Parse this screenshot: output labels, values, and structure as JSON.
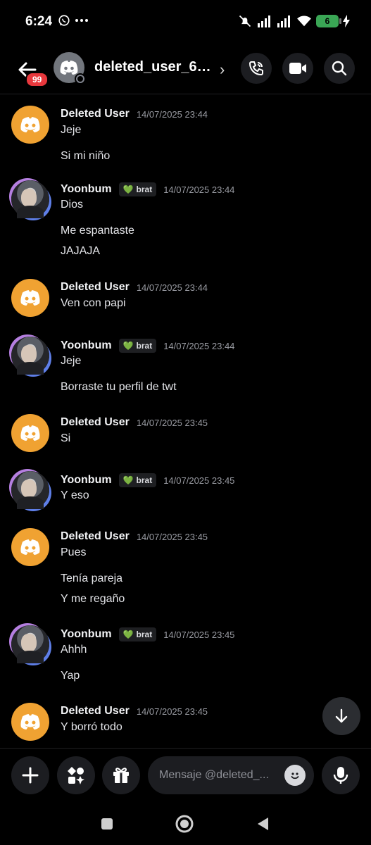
{
  "status_bar": {
    "time": "6:24",
    "battery": "6"
  },
  "header": {
    "title": "deleted_user_69...",
    "unread_badge": "99"
  },
  "messages": [
    {
      "author": "Deleted User",
      "avatar": "discord-logo",
      "timestamp": "14/07/2025 23:44",
      "lines": [
        "Jeje",
        "Si mi niño"
      ]
    },
    {
      "author": "Yoonbum",
      "avatar": "photo",
      "tag": "brat",
      "timestamp": "14/07/2025 23:44",
      "lines": [
        "Dios",
        "Me espantaste",
        "JAJAJA"
      ]
    },
    {
      "author": "Deleted User",
      "avatar": "discord-logo",
      "timestamp": "14/07/2025 23:44",
      "lines": [
        "Ven con papi"
      ]
    },
    {
      "author": "Yoonbum",
      "avatar": "photo",
      "tag": "brat",
      "timestamp": "14/07/2025 23:44",
      "lines": [
        "Jeje",
        "Borraste tu perfil de twt"
      ]
    },
    {
      "author": "Deleted User",
      "avatar": "discord-logo",
      "timestamp": "14/07/2025 23:45",
      "lines": [
        "Si"
      ]
    },
    {
      "author": "Yoonbum",
      "avatar": "photo",
      "tag": "brat",
      "timestamp": "14/07/2025 23:45",
      "lines": [
        "Y eso"
      ]
    },
    {
      "author": "Deleted User",
      "avatar": "discord-logo",
      "timestamp": "14/07/2025 23:45",
      "lines": [
        "Pues",
        "Tenía pareja",
        "Y me regaño"
      ]
    },
    {
      "author": "Yoonbum",
      "avatar": "photo",
      "tag": "brat",
      "timestamp": "14/07/2025 23:45",
      "lines": [
        "Ahhh",
        "Yap"
      ]
    },
    {
      "author": "Deleted User",
      "avatar": "discord-logo",
      "timestamp": "14/07/2025 23:45",
      "lines": [
        "Y borró todo"
      ]
    }
  ],
  "composer": {
    "placeholder": "Mensaje @deleted_..."
  },
  "colors": {
    "background": "#000000",
    "discord_avatar": "#f0a232",
    "badge": "#e8383d",
    "tag_heart": "#8fdc4a"
  },
  "icons": [
    "whatsapp-icon",
    "more-icon",
    "mute-icon",
    "signal-icon",
    "wifi-icon",
    "battery-icon",
    "charging-icon",
    "back-arrow-icon",
    "discord-logo-icon",
    "chevron-right-icon",
    "voice-call-icon",
    "video-call-icon",
    "search-icon",
    "scroll-down-icon",
    "plus-icon",
    "apps-icon",
    "gift-icon",
    "emoji-icon",
    "microphone-icon",
    "recents-icon",
    "home-icon",
    "back-icon"
  ]
}
